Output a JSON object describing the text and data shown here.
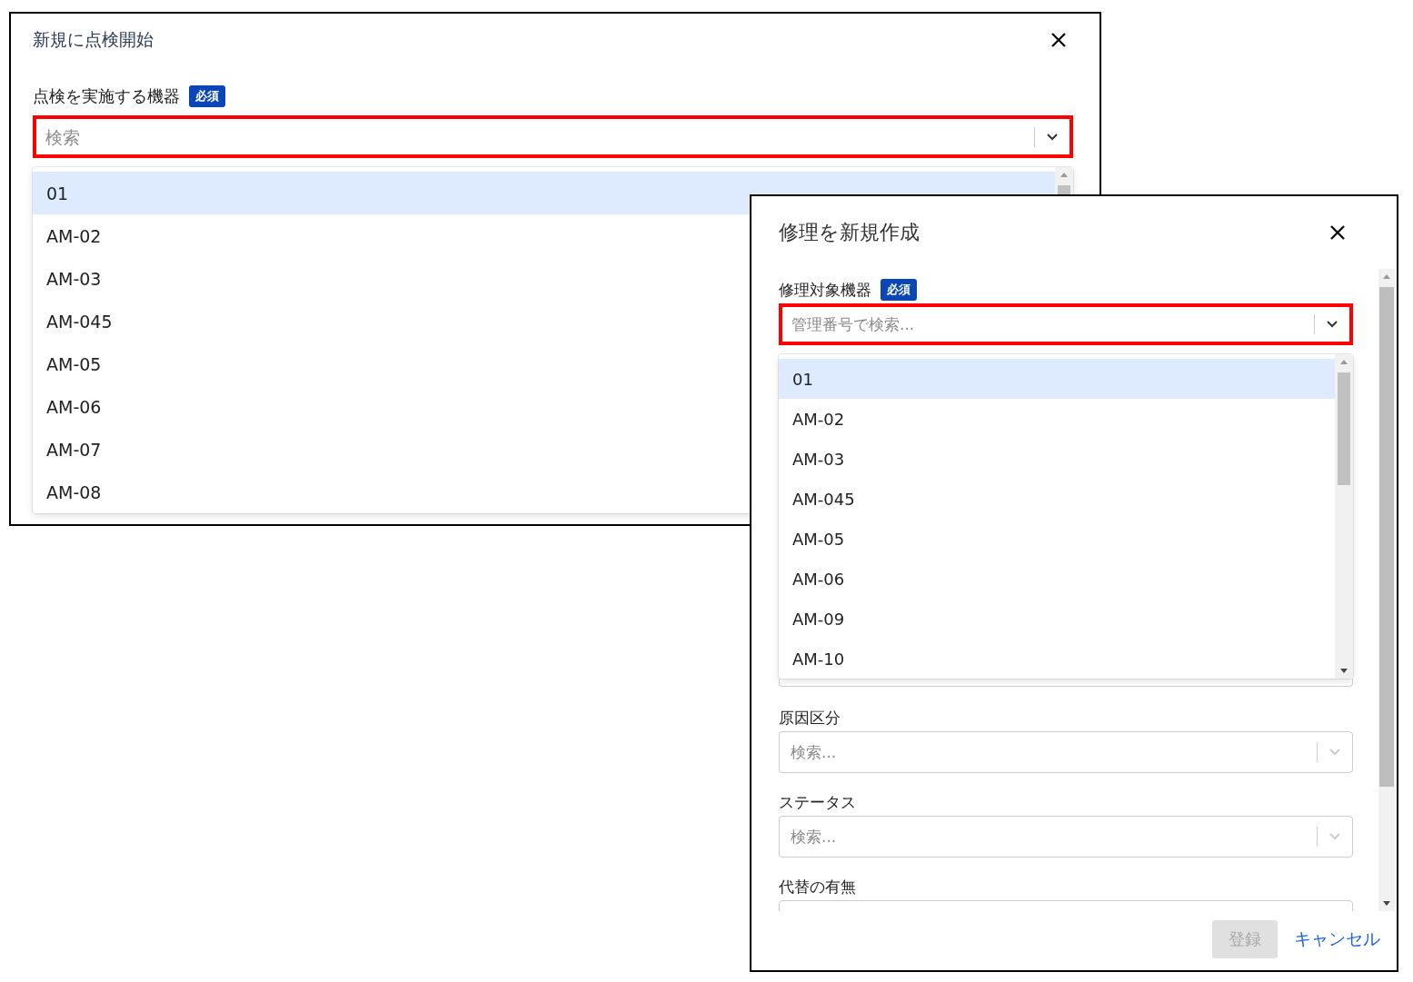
{
  "windows": [
    {
      "title": "新規に点検開始",
      "fields": [
        {
          "label": "点検を実施する機器",
          "required_badge": "必須",
          "placeholder": "検索",
          "annotated": true,
          "open": true,
          "options": [
            {
              "label": "01",
              "selected": true
            },
            {
              "label": "AM-02",
              "selected": false
            },
            {
              "label": "AM-03",
              "selected": false
            },
            {
              "label": "AM-045",
              "selected": false
            },
            {
              "label": "AM-05",
              "selected": false
            },
            {
              "label": "AM-06",
              "selected": false
            },
            {
              "label": "AM-07",
              "selected": false
            },
            {
              "label": "AM-08",
              "selected": false
            }
          ]
        }
      ]
    },
    {
      "title": "修理を新規作成",
      "fields": [
        {
          "label": "修理対象機器",
          "required_badge": "必須",
          "placeholder": "管理番号で検索...",
          "annotated": true,
          "open": true,
          "options": [
            {
              "label": "01",
              "selected": true
            },
            {
              "label": "AM-02",
              "selected": false
            },
            {
              "label": "AM-03",
              "selected": false
            },
            {
              "label": "AM-045",
              "selected": false
            },
            {
              "label": "AM-05",
              "selected": false
            },
            {
              "label": "AM-06",
              "selected": false
            },
            {
              "label": "AM-09",
              "selected": false
            },
            {
              "label": "AM-10",
              "selected": false
            }
          ]
        },
        {
          "label": "原因区分",
          "placeholder": "検索...",
          "annotated": false,
          "open": false
        },
        {
          "label": "ステータス",
          "placeholder": "検索...",
          "annotated": false,
          "open": false
        },
        {
          "label": "代替の有無",
          "annotated": false
        }
      ],
      "buttons": [
        {
          "label": "登録",
          "kind": "primary",
          "disabled": true
        },
        {
          "label": "キャンセル",
          "kind": "link",
          "disabled": false
        }
      ]
    }
  ]
}
